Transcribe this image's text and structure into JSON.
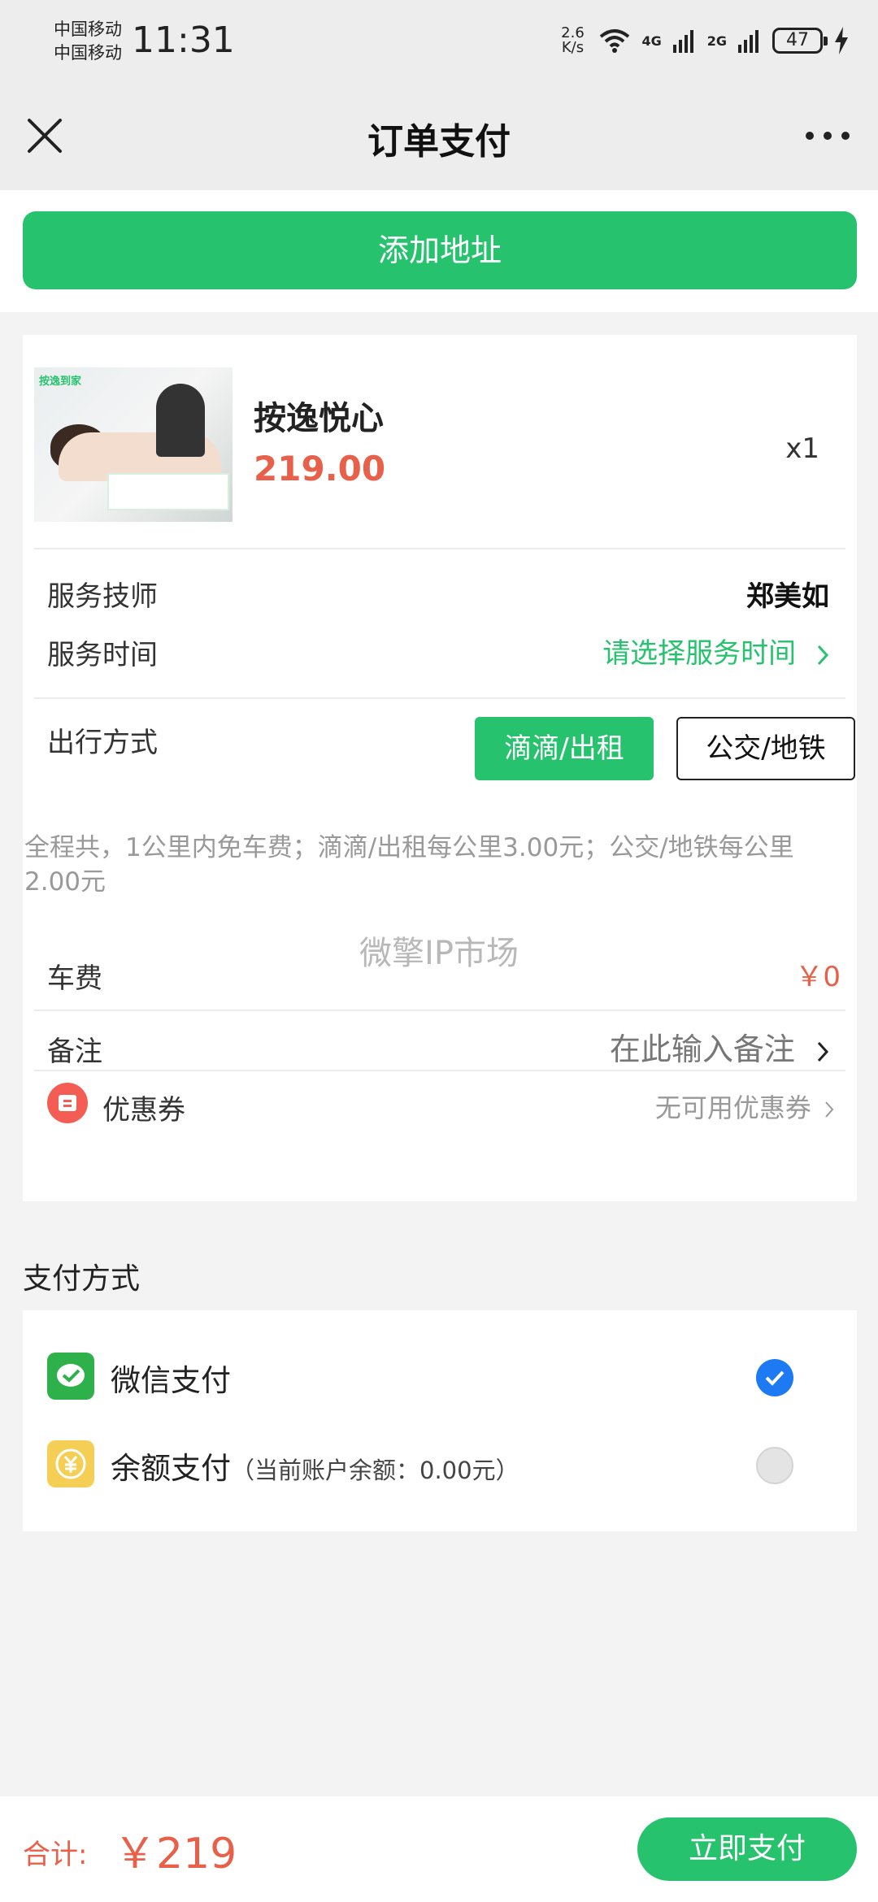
{
  "status_bar": {
    "carrier_1": "中国移动",
    "carrier_2": "中国移动",
    "time": "11:31",
    "speed_value": "2.6",
    "speed_unit": "K/s",
    "net_4g": "4G",
    "net_2g": "2G",
    "battery": "47"
  },
  "nav": {
    "title": "订单支付"
  },
  "address": {
    "button_label": "添加地址"
  },
  "product": {
    "image_tag": "按逸到家",
    "name": "按逸悦心",
    "price": "219.00",
    "quantity": "x1"
  },
  "details": {
    "technician_label": "服务技师",
    "technician_value": "郑美如",
    "time_label": "服务时间",
    "time_value": "请选择服务时间",
    "transport_label": "出行方式",
    "transport_options": [
      "滴滴/出租",
      "公交/地铁"
    ],
    "transport_note": "全程共，1公里内免车费；滴滴/出租每公里3.00元；公交/地铁每公里2.00元",
    "fare_label": "车费",
    "fare_value": "￥0",
    "remark_label": "备注",
    "remark_placeholder": "在此输入备注",
    "coupon_label": "优惠券",
    "coupon_value": "无可用优惠券"
  },
  "watermark": "微擎IP市场",
  "payment": {
    "title": "支付方式",
    "methods": [
      {
        "label": "微信支付",
        "sub": "",
        "selected": true
      },
      {
        "label": "余额支付",
        "sub": "（当前账户余额：0.00元）",
        "selected": false
      }
    ]
  },
  "footer": {
    "total_label": "合计:",
    "total_value": "￥219",
    "pay_button": "立即支付"
  },
  "colors": {
    "accent_green": "#27c26d",
    "price_red": "#e8604a",
    "radio_blue": "#1e7af3"
  }
}
